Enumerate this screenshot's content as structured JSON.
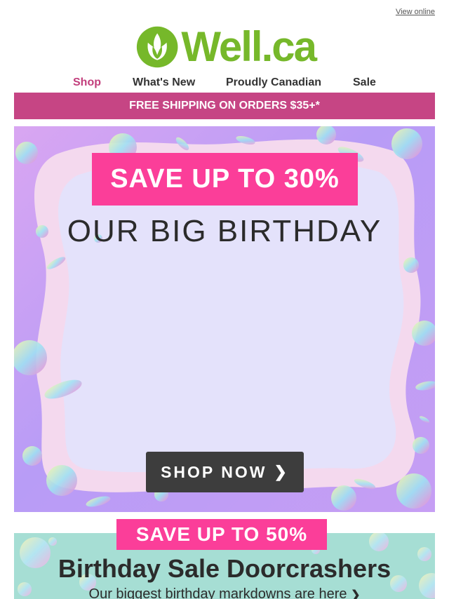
{
  "header": {
    "view_online": "View online",
    "logo_text": "Well.ca",
    "brand_color": "#76b82a"
  },
  "nav": {
    "items": [
      {
        "label": "Shop",
        "active": true
      },
      {
        "label": "What's New"
      },
      {
        "label": "Proudly Canadian"
      },
      {
        "label": "Sale"
      }
    ],
    "active_color": "#c23e7c"
  },
  "promo_bar": {
    "text": "FREE SHIPPING ON ORDERS $35+*",
    "color": "#c64584"
  },
  "hero": {
    "badge": "SAVE UP TO 30%",
    "title": "OUR BIG BIRTHDAY",
    "button": "SHOP NOW",
    "button_icon": "chevron-right-icon",
    "badge_color": "#fb3e99"
  },
  "doorcrashers": {
    "badge": "SAVE UP TO 50%",
    "title": "Birthday Sale Doorcrashers",
    "subtitle": "Our biggest birthday markdowns are here",
    "subtitle_icon": "chevron-right-icon",
    "bg_color": "#a6ded4"
  }
}
